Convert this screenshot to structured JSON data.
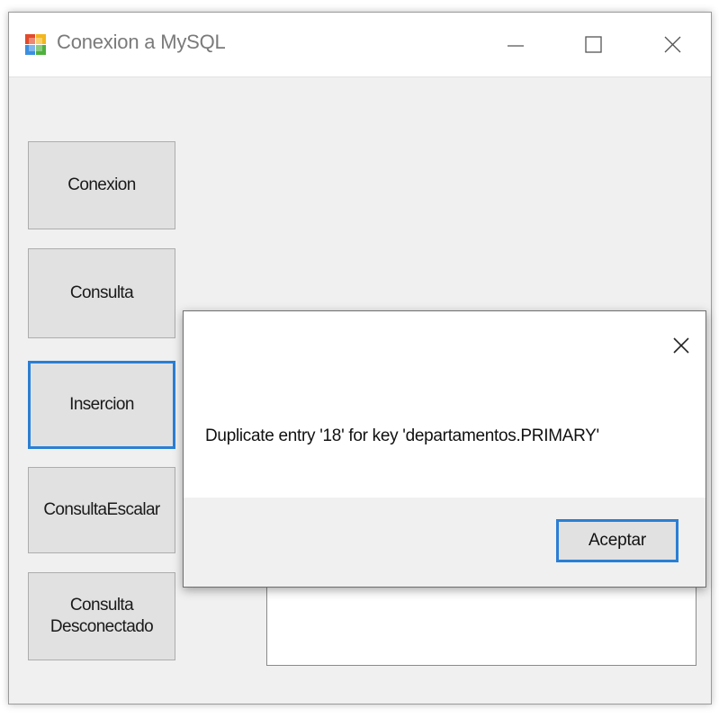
{
  "window": {
    "title": "Conexion a MySQL",
    "app_icon": "winforms-app-icon",
    "controls": {
      "minimize": "minimize-icon",
      "maximize": "maximize-icon",
      "close": "close-icon"
    }
  },
  "sidebar": {
    "buttons": [
      {
        "label": "Conexion"
      },
      {
        "label": "Consulta"
      },
      {
        "label": "Insercion",
        "focused": true
      },
      {
        "label": "ConsultaEscalar"
      },
      {
        "label": "Consulta\nDesconectado"
      }
    ]
  },
  "dialog": {
    "message": "Duplicate entry '18' for key 'departamentos.PRIMARY'",
    "ok_label": "Aceptar",
    "close_icon": "close-icon"
  },
  "colors": {
    "focus_border": "#2a7fd4",
    "form_background": "#f0f0f0",
    "button_face": "#e1e1e1"
  }
}
